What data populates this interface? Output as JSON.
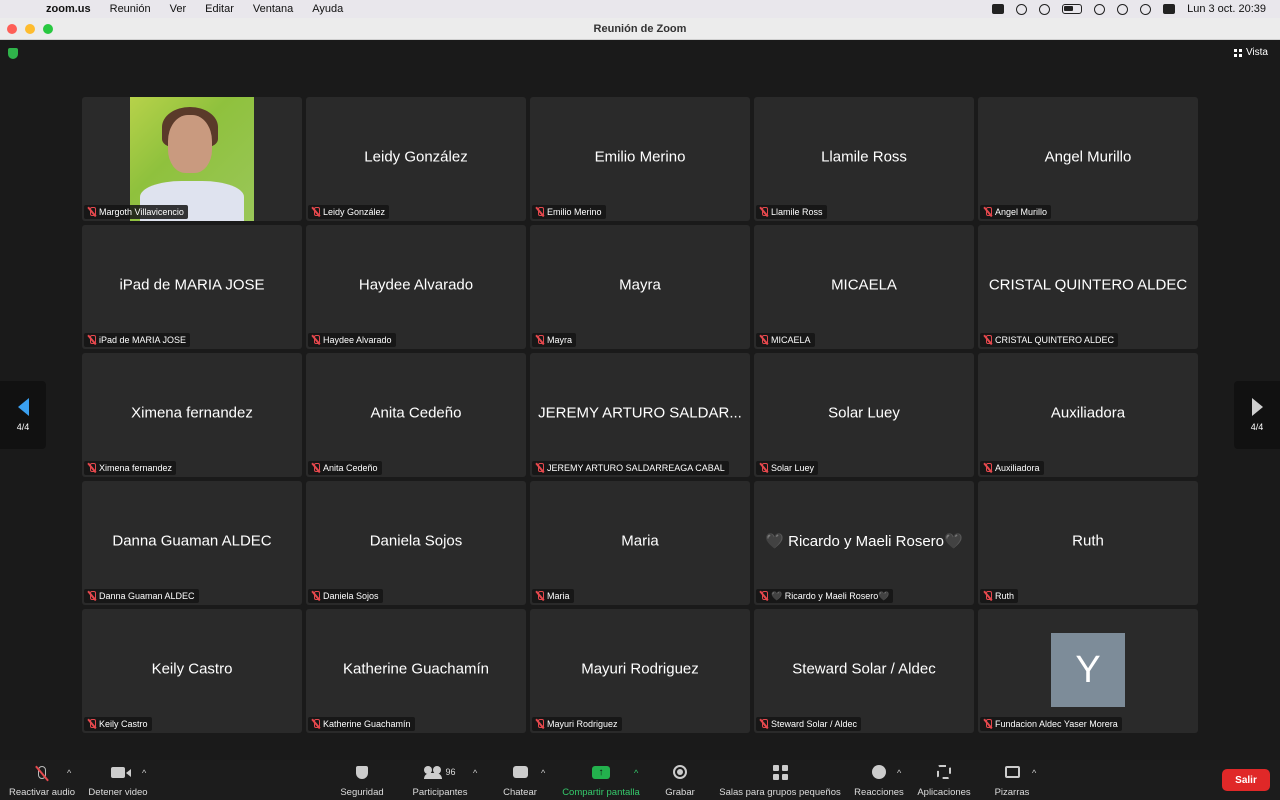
{
  "menubar": {
    "app": "zoom.us",
    "items": [
      "Reunión",
      "Ver",
      "Editar",
      "Ventana",
      "Ayuda"
    ],
    "clock": "Lun 3 oct.  20:39"
  },
  "window": {
    "title": "Reunión de Zoom"
  },
  "meeting": {
    "view_label": "Vista",
    "page_indicator": "4/4",
    "tiles": [
      {
        "display": "",
        "tag": "Margoth Villavicencio",
        "kind": "photo"
      },
      {
        "display": "Leidy González",
        "tag": "Leidy González"
      },
      {
        "display": "Emilio Merino",
        "tag": "Emilio Merino"
      },
      {
        "display": "Llamile Ross",
        "tag": "Llamile Ross"
      },
      {
        "display": "Angel Murillo",
        "tag": "Angel Murillo"
      },
      {
        "display": "iPad de MARIA JOSE",
        "tag": "iPad de MARIA JOSE"
      },
      {
        "display": "Haydee Alvarado",
        "tag": "Haydee Alvarado"
      },
      {
        "display": "Mayra",
        "tag": "Mayra"
      },
      {
        "display": "MICAELA",
        "tag": "MICAELA"
      },
      {
        "display": "CRISTAL QUINTERO ALDEC",
        "tag": "CRISTAL QUINTERO ALDEC"
      },
      {
        "display": "Ximena fernandez",
        "tag": "Ximena fernandez"
      },
      {
        "display": "Anita Cedeño",
        "tag": "Anita Cedeño"
      },
      {
        "display": "JEREMY ARTURO SALDAR...",
        "tag": "JEREMY ARTURO SALDARREAGA CABAL"
      },
      {
        "display": "Solar Luey",
        "tag": "Solar Luey"
      },
      {
        "display": "Auxiliadora",
        "tag": "Auxiliadora"
      },
      {
        "display": "Danna Guaman ALDEC",
        "tag": "Danna Guaman ALDEC"
      },
      {
        "display": "Daniela Sojos",
        "tag": "Daniela Sojos"
      },
      {
        "display": "Maria",
        "tag": "Maria"
      },
      {
        "display": "🖤 Ricardo y Maeli  Rosero🖤",
        "tag": "🖤 Ricardo y Maeli  Rosero🖤"
      },
      {
        "display": "Ruth",
        "tag": "Ruth"
      },
      {
        "display": "Keily Castro",
        "tag": "Keily Castro"
      },
      {
        "display": "Katherine Guachamín",
        "tag": "Katherine Guachamín"
      },
      {
        "display": "Mayuri Rodriguez",
        "tag": "Mayuri Rodriguez"
      },
      {
        "display": "Steward Solar / Aldec",
        "tag": "Steward Solar / Aldec"
      },
      {
        "display": "",
        "tag": "Fundacion Aldec Yaser Morera",
        "kind": "avatar",
        "avatar_letter": "Y"
      }
    ]
  },
  "toolbar": {
    "unmute": "Reactivar audio",
    "stop_video": "Detener video",
    "security": "Seguridad",
    "participants": "Participantes",
    "participants_count": "96",
    "chat": "Chatear",
    "share": "Compartir pantalla",
    "record": "Grabar",
    "breakout": "Salas para grupos pequeños",
    "reactions": "Reacciones",
    "apps": "Aplicaciones",
    "whiteboards": "Pizarras",
    "leave": "Salir"
  },
  "colors": {
    "share_green": "#23b14d",
    "leave_red": "#e02828",
    "mute_red": "#e5484d"
  }
}
